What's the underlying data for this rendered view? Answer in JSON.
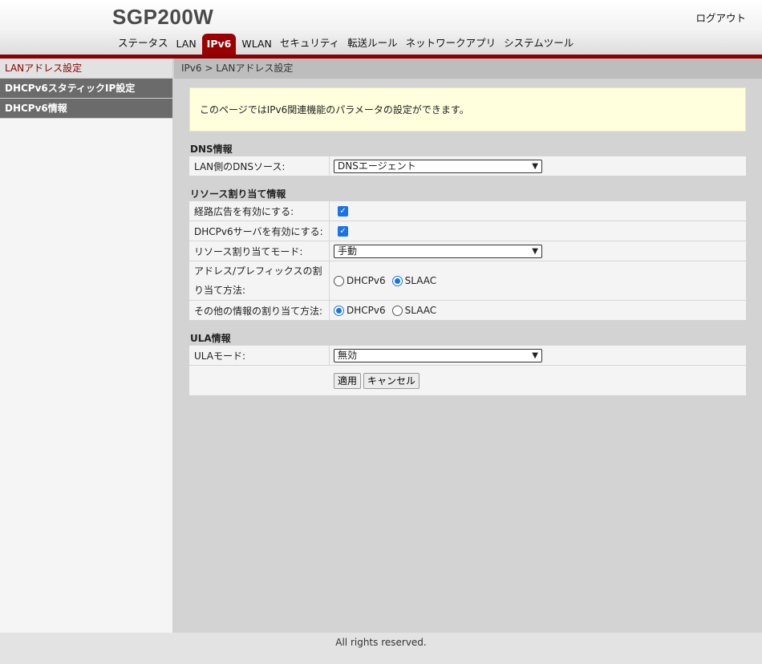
{
  "header": {
    "brand": "SGP200W",
    "logout": "ログアウト",
    "nav": [
      "ステータス",
      "LAN",
      "IPv6",
      "WLAN",
      "セキュリティ",
      "転送ルール",
      "ネットワークアプリ",
      "システムツール"
    ],
    "active_nav": "IPv6"
  },
  "sidebar": {
    "items": [
      "LANアドレス設定",
      "DHCPv6スタティックIP設定",
      "DHCPv6情報"
    ]
  },
  "breadcrumb": "IPv6 > LANアドレス設定",
  "notice": "このページではIPv6関連機能のパラメータの設定ができます。",
  "dns": {
    "title": "DNS情報",
    "source_label": "LAN側のDNSソース:",
    "source_value": "DNSエージェント"
  },
  "resource": {
    "title": "リソース割り当て情報",
    "ra_label": "経路広告を有効にする:",
    "ra_checked": true,
    "dhcp_label": "DHCPv6サーバを有効にする:",
    "dhcp_checked": true,
    "mode_label": "リソース割り当てモード:",
    "mode_value": "手動",
    "prefix_label": "アドレス/プレフィックスの割り当て方法:",
    "prefix_options": [
      "DHCPv6",
      "SLAAC"
    ],
    "prefix_selected": "SLAAC",
    "other_label": "その他の情報の割り当て方法:",
    "other_options": [
      "DHCPv6",
      "SLAAC"
    ],
    "other_selected": "DHCPv6"
  },
  "ula": {
    "title": "ULA情報",
    "mode_label": "ULAモード:",
    "mode_value": "無効"
  },
  "buttons": {
    "apply": "適用",
    "cancel": "キャンセル"
  },
  "footer": "All rights reserved.",
  "colors": {
    "accent": "#8b0000",
    "checkbox": "#1a73e8",
    "notice_bg": "#ffffdd"
  }
}
